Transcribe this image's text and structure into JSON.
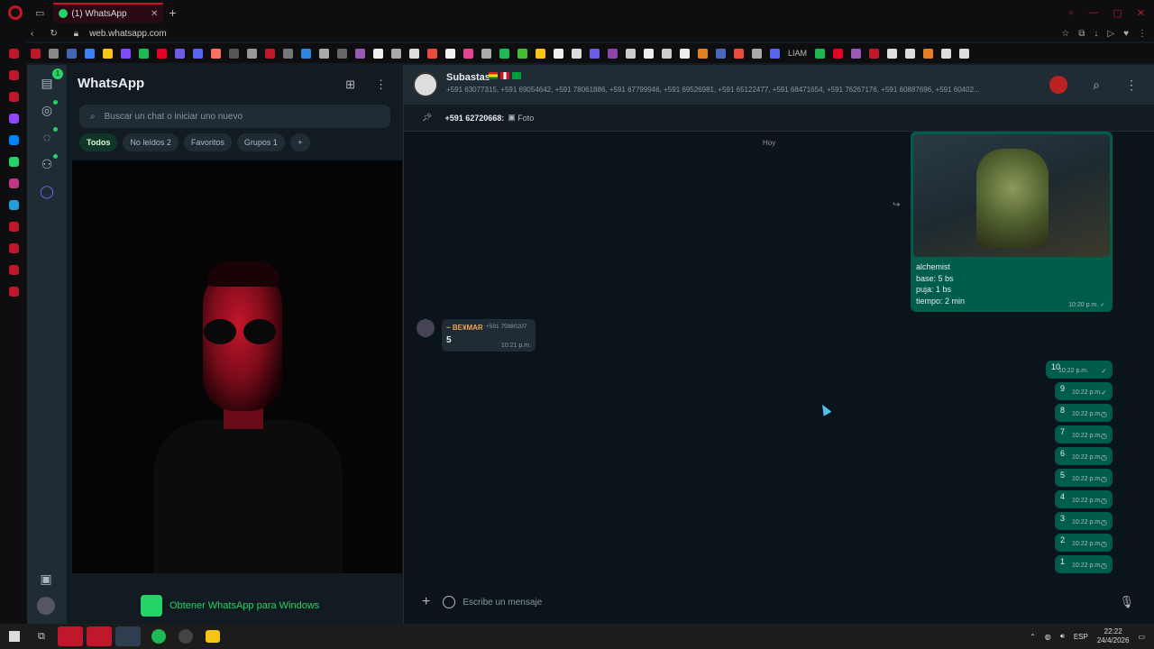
{
  "browser": {
    "tab_title": "(1) WhatsApp",
    "url": "web.whatsapp.com",
    "bookmark_text": "LIAM",
    "accent": "#c0182a"
  },
  "whatsapp": {
    "title": "WhatsApp",
    "unread_badge": "1",
    "search_placeholder": "Buscar un chat o iniciar uno nuevo",
    "filters": {
      "todos": "Todos",
      "no_leidos": "No leídos 2",
      "favoritos": "Favoritos",
      "grupos": "Grupos 1"
    },
    "get_windows": "Obtener WhatsApp para Windows",
    "brand_color": "#25d366"
  },
  "chat": {
    "group_name": "Subastas",
    "members": "+591 63077315, +591 69054642, +591 78061886, +591 67799946, +591 69526981, +591 65122477, +591 68471654, +591 76267176, +591 60887696, +591 60402...",
    "pinned_sender": "+591 62720668:",
    "pinned_text": "Foto",
    "day": "Hoy",
    "image_message": {
      "caption_line1": "alchemist",
      "caption_line2": "base: 5 bs",
      "caption_line3": "puja: 1 bs",
      "caption_line4": "tiempo: 2 min",
      "time": "10:20 p.m."
    },
    "incoming": {
      "sender": "~ BE¥MAR",
      "phone": "+591 75980207",
      "text": "5",
      "time": "10:21 p.m."
    },
    "outgoing": [
      {
        "text": "10",
        "time": "10:22 p.m.",
        "status": "✓"
      },
      {
        "text": "9",
        "time": "10:22 p.m.",
        "status": "✓"
      },
      {
        "text": "8",
        "time": "10:22 p.m.",
        "status": "◷"
      },
      {
        "text": "7",
        "time": "10:22 p.m.",
        "status": "◷"
      },
      {
        "text": "6",
        "time": "10:22 p.m.",
        "status": "◷"
      },
      {
        "text": "5",
        "time": "10:22 p.m.",
        "status": "◷"
      },
      {
        "text": "4",
        "time": "10:22 p.m.",
        "status": "◷"
      },
      {
        "text": "3",
        "time": "10:22 p.m.",
        "status": "◷"
      },
      {
        "text": "2",
        "time": "10:22 p.m.",
        "status": "◷"
      },
      {
        "text": "1",
        "time": "10:22 p.m.",
        "status": "◷"
      }
    ],
    "composer_placeholder": "Escribe un mensaje"
  },
  "taskbar": {
    "lang": "ESP",
    "time": "22:22",
    "date": "24/4/2026"
  }
}
